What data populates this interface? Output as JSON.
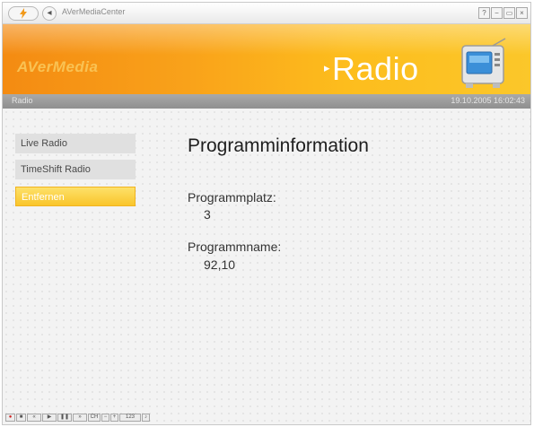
{
  "window": {
    "title": "AVerMediaCenter",
    "controls": {
      "help": "?",
      "minimize": "−",
      "restore": "▭",
      "close": "×"
    }
  },
  "banner": {
    "brand": "AVerMedia",
    "section_title": "Radio",
    "arrow": "▸"
  },
  "status": {
    "breadcrumb": "Radio",
    "datetime": "19.10.2005 16:02:43"
  },
  "menu": {
    "items": [
      {
        "label": "Live Radio",
        "active": false
      },
      {
        "label": "TimeShift Radio",
        "active": false
      },
      {
        "label": "Entfernen",
        "active": true
      }
    ]
  },
  "info": {
    "heading": "Programminformation",
    "fields": [
      {
        "label": "Programmplatz:",
        "value": "3"
      },
      {
        "label": "Programmname:",
        "value": "92,10"
      }
    ]
  },
  "player_controls": [
    {
      "icon": "record-icon",
      "glyph": "●"
    },
    {
      "icon": "stop-icon",
      "glyph": "■"
    },
    {
      "icon": "rewind-icon",
      "glyph": "«"
    },
    {
      "icon": "play-icon",
      "glyph": "▶"
    },
    {
      "icon": "pause-icon",
      "glyph": "❚❚"
    },
    {
      "icon": "forward-icon",
      "glyph": "»"
    },
    {
      "icon": "channel-icon",
      "glyph": "CH"
    },
    {
      "icon": "volume-down-icon",
      "glyph": "−"
    },
    {
      "icon": "volume-up-icon",
      "glyph": "+"
    },
    {
      "icon": "keypad-icon",
      "glyph": "123"
    },
    {
      "icon": "mute-icon",
      "glyph": "♪"
    }
  ],
  "colors": {
    "banner_orange": "#f9a21a",
    "active_menu": "#f9c52b",
    "status_bar": "#9a9a9a"
  }
}
